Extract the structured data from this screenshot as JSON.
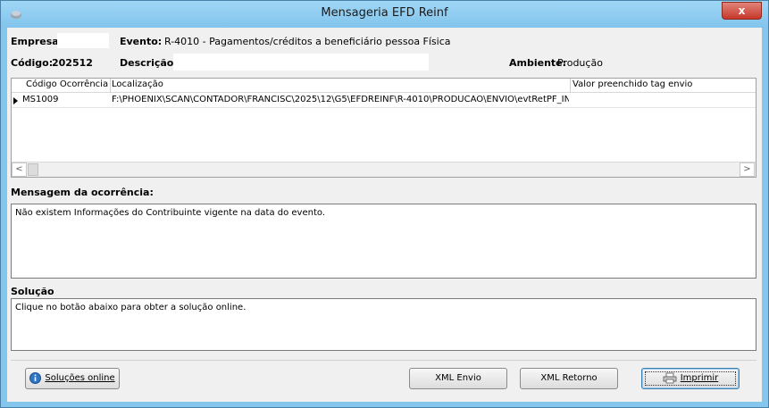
{
  "window": {
    "title": "Mensageria EFD Reinf",
    "close_label": "x"
  },
  "header": {
    "empresa_label": "Empresa",
    "empresa_value": "",
    "evento_label": "Evento:",
    "evento_value": "R-4010 - Pagamentos/créditos a beneficiário pessoa Física",
    "codigo_label": "Código:",
    "codigo_value": "202512",
    "descricao_label": "Descrição:",
    "descricao_value": "",
    "ambiente_label": "Ambiente:",
    "ambiente_value": "Produção"
  },
  "grid": {
    "columns": [
      "Código Ocorrência",
      "Localização",
      "Valor preenchido tag envio"
    ],
    "rows": [
      {
        "codigo": "MS1009",
        "localizacao": "F:\\PHOENIX\\SCAN\\CONTADOR\\FRANCISC\\2025\\12\\G5\\EFDREINF\\R-4010\\PRODUCAO\\ENVIO\\evtRetPF_INCLU",
        "valor": ""
      }
    ],
    "scroll_left": "<",
    "scroll_right": ">"
  },
  "mensagem": {
    "label": "Mensagem da ocorrência:",
    "text": "Não existem Informações do Contribuinte vigente na data do evento."
  },
  "solucao": {
    "label": "Solução",
    "text": "Clique no botão abaixo para obter a solução online."
  },
  "buttons": {
    "solucoes_online": "Soluções online",
    "xml_envio": "XML Envio",
    "xml_retorno": "XML Retorno",
    "imprimir": "Imprimir"
  },
  "colors": {
    "title_bar": "#85c6ec",
    "close_button": "#c7382a"
  },
  "icons": {
    "app": "app-icon",
    "info": "info-icon",
    "printer": "printer-icon"
  }
}
